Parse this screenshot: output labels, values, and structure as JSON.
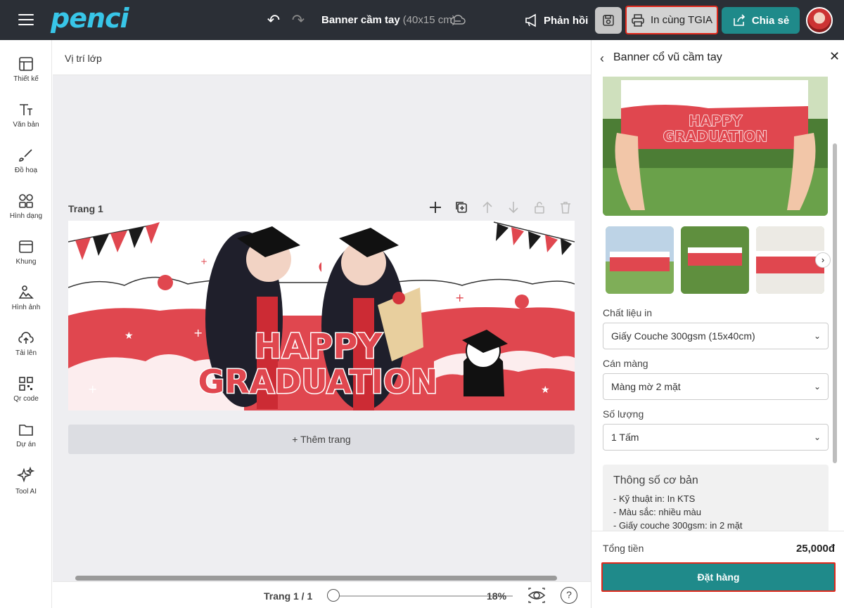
{
  "topbar": {
    "logo": "penci",
    "doc_title": "Banner cầm tay",
    "doc_size": "(40x15 cm)",
    "feedback_label": "Phản hồi",
    "print_label": "In cùng TGIA",
    "share_label": "Chia sẻ"
  },
  "sidebar": {
    "items": [
      {
        "label": "Thiết kế",
        "icon": "layout-icon"
      },
      {
        "label": "Văn bản",
        "icon": "text-icon"
      },
      {
        "label": "Đồ hoạ",
        "icon": "brush-icon"
      },
      {
        "label": "Hình dạng",
        "icon": "shapes-icon"
      },
      {
        "label": "Khung",
        "icon": "frame-icon"
      },
      {
        "label": "Hình ảnh",
        "icon": "image-icon"
      },
      {
        "label": "Tải lên",
        "icon": "upload-icon"
      },
      {
        "label": "Qr code",
        "icon": "qr-icon"
      },
      {
        "label": "Dự án",
        "icon": "folder-icon"
      },
      {
        "label": "Tool AI",
        "icon": "sparkle-icon"
      }
    ]
  },
  "canvas": {
    "layer_label": "Vị trí lớp",
    "page_label": "Trang 1",
    "banner_line1": "HAPPY",
    "banner_line2": "GRADUATION",
    "add_page_label": "+ Thêm trang",
    "page_indicator": "Trang 1 / 1",
    "zoom": "18%",
    "help": "?"
  },
  "panel": {
    "title": "Banner cổ vũ cầm tay",
    "photo_line1": "HAPPY",
    "photo_line2": "GRADUATION",
    "material_label": "Chất liệu in",
    "material_value": "Giấy Couche 300gsm (15x40cm)",
    "lamination_label": "Cán màng",
    "lamination_value": "Màng mờ 2 mặt",
    "quantity_label": "Số lượng",
    "quantity_value": "1 Tấm",
    "spec_title": "Thông số cơ bản",
    "spec_lines": [
      "- Kỹ thuật in: In KTS",
      "- Màu sắc: nhiều màu",
      "- Giấy couche 300gsm: in 2 mặt"
    ],
    "total_label": "Tổng tiền",
    "total_value": "25,000đ",
    "order_label": "Đặt hàng"
  },
  "colors": {
    "topbar_bg": "#2b2f36",
    "accent_teal": "#1f8a8a",
    "highlight_red": "#e0281b",
    "banner_red": "#e0474f",
    "logo_blue": "#38c6e8"
  }
}
